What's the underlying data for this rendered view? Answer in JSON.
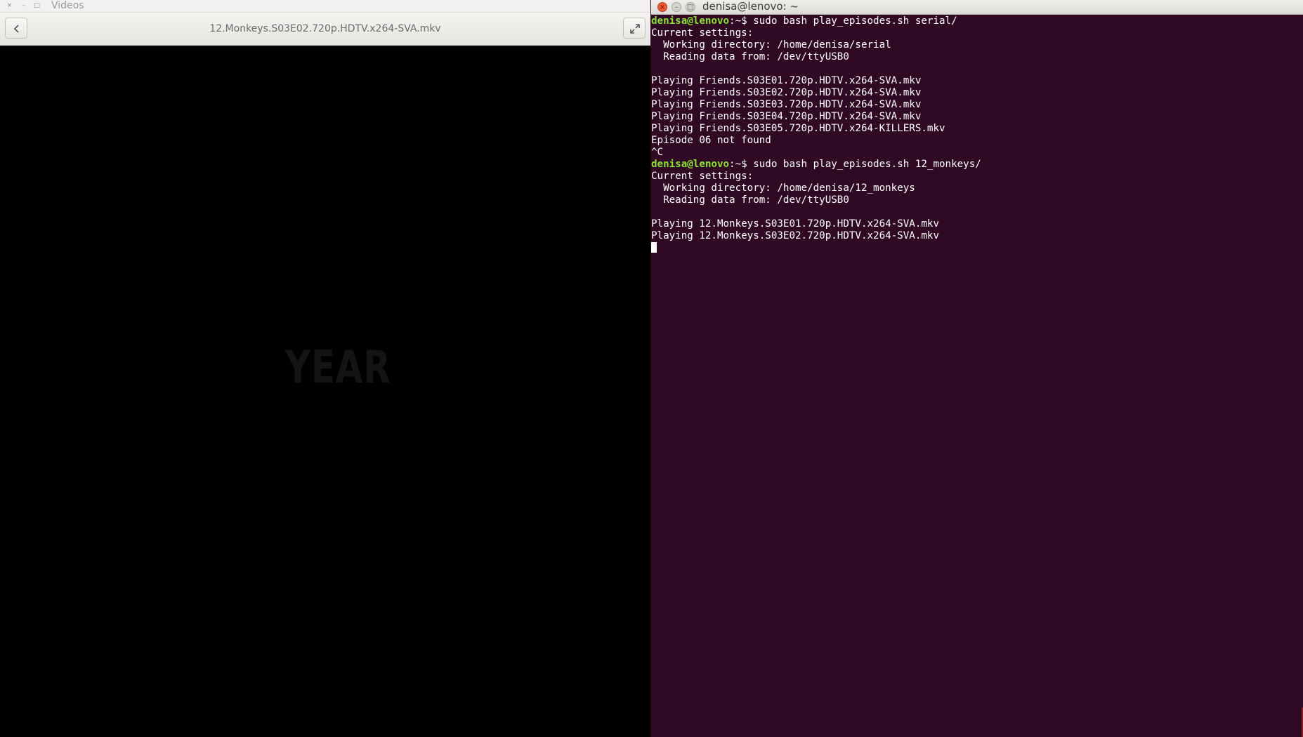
{
  "videos": {
    "title": "Videos",
    "file_name": "12.Monkeys.S03E02.720p.HDTV.x264-SVA.mkv",
    "frame_text": "YEAR",
    "window_controls": {
      "close": "×",
      "minimize": "–",
      "maximize": "□"
    },
    "icons": {
      "back": "chevron-left-icon",
      "fullscreen": "expand-icon"
    }
  },
  "terminal": {
    "title": "denisa@lenovo: ~",
    "window_controls": {
      "close": "×",
      "minimize": "–",
      "maximize": "□"
    },
    "lines": [
      {
        "user": "denisa@lenovo",
        "path": ":~$",
        "cmd": " sudo bash play_episodes.sh serial/"
      },
      {
        "text": "Current settings:"
      },
      {
        "text": "  Working directory: /home/denisa/serial"
      },
      {
        "text": "  Reading data from: /dev/ttyUSB0"
      },
      {
        "text": ""
      },
      {
        "text": "Playing Friends.S03E01.720p.HDTV.x264-SVA.mkv"
      },
      {
        "text": "Playing Friends.S03E02.720p.HDTV.x264-SVA.mkv"
      },
      {
        "text": "Playing Friends.S03E03.720p.HDTV.x264-SVA.mkv"
      },
      {
        "text": "Playing Friends.S03E04.720p.HDTV.x264-SVA.mkv"
      },
      {
        "text": "Playing Friends.S03E05.720p.HDTV.x264-KILLERS.mkv"
      },
      {
        "text": "Episode 06 not found"
      },
      {
        "text": "^C"
      },
      {
        "user": "denisa@lenovo",
        "path": ":~$",
        "cmd": " sudo bash play_episodes.sh 12_monkeys/"
      },
      {
        "text": "Current settings:"
      },
      {
        "text": "  Working directory: /home/denisa/12_monkeys"
      },
      {
        "text": "  Reading data from: /dev/ttyUSB0"
      },
      {
        "text": ""
      },
      {
        "text": "Playing 12.Monkeys.S03E01.720p.HDTV.x264-SVA.mkv"
      },
      {
        "text": "Playing 12.Monkeys.S03E02.720p.HDTV.x264-SVA.mkv"
      }
    ]
  },
  "colors": {
    "terminal_bg": "#300a24",
    "prompt_user": "#8ae234",
    "close_button": "#ee5a34"
  }
}
